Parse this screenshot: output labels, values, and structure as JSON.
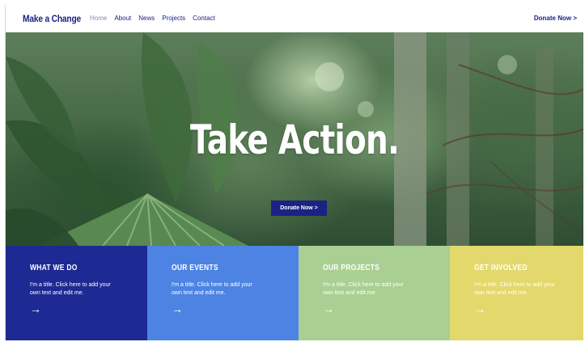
{
  "header": {
    "logo": "Make a Change",
    "nav": [
      "Home",
      "About",
      "News",
      "Projects",
      "Contact"
    ],
    "donate": "Donate Now >"
  },
  "hero": {
    "title": "Take Action.",
    "button": "Donate Now >"
  },
  "cards": [
    {
      "title": "WHAT WE DO",
      "text": "I'm a title. Click here to add your own text and edit me.",
      "arrow": "→",
      "color": "#1e2a93"
    },
    {
      "title": "OUR EVENTS",
      "text": "I'm a title. Click here to add your own text and edit me.",
      "arrow": "→",
      "color": "#4d84e3"
    },
    {
      "title": "OUR PROJECTS",
      "text": "I'm a title. Click here to add your own text and edit me.",
      "arrow": "→",
      "color": "#a9cf92"
    },
    {
      "title": "GET INVOLVED",
      "text": "I'm a title. Click here to add your own text and edit me.",
      "arrow": "→",
      "color": "#e3d86b"
    }
  ]
}
